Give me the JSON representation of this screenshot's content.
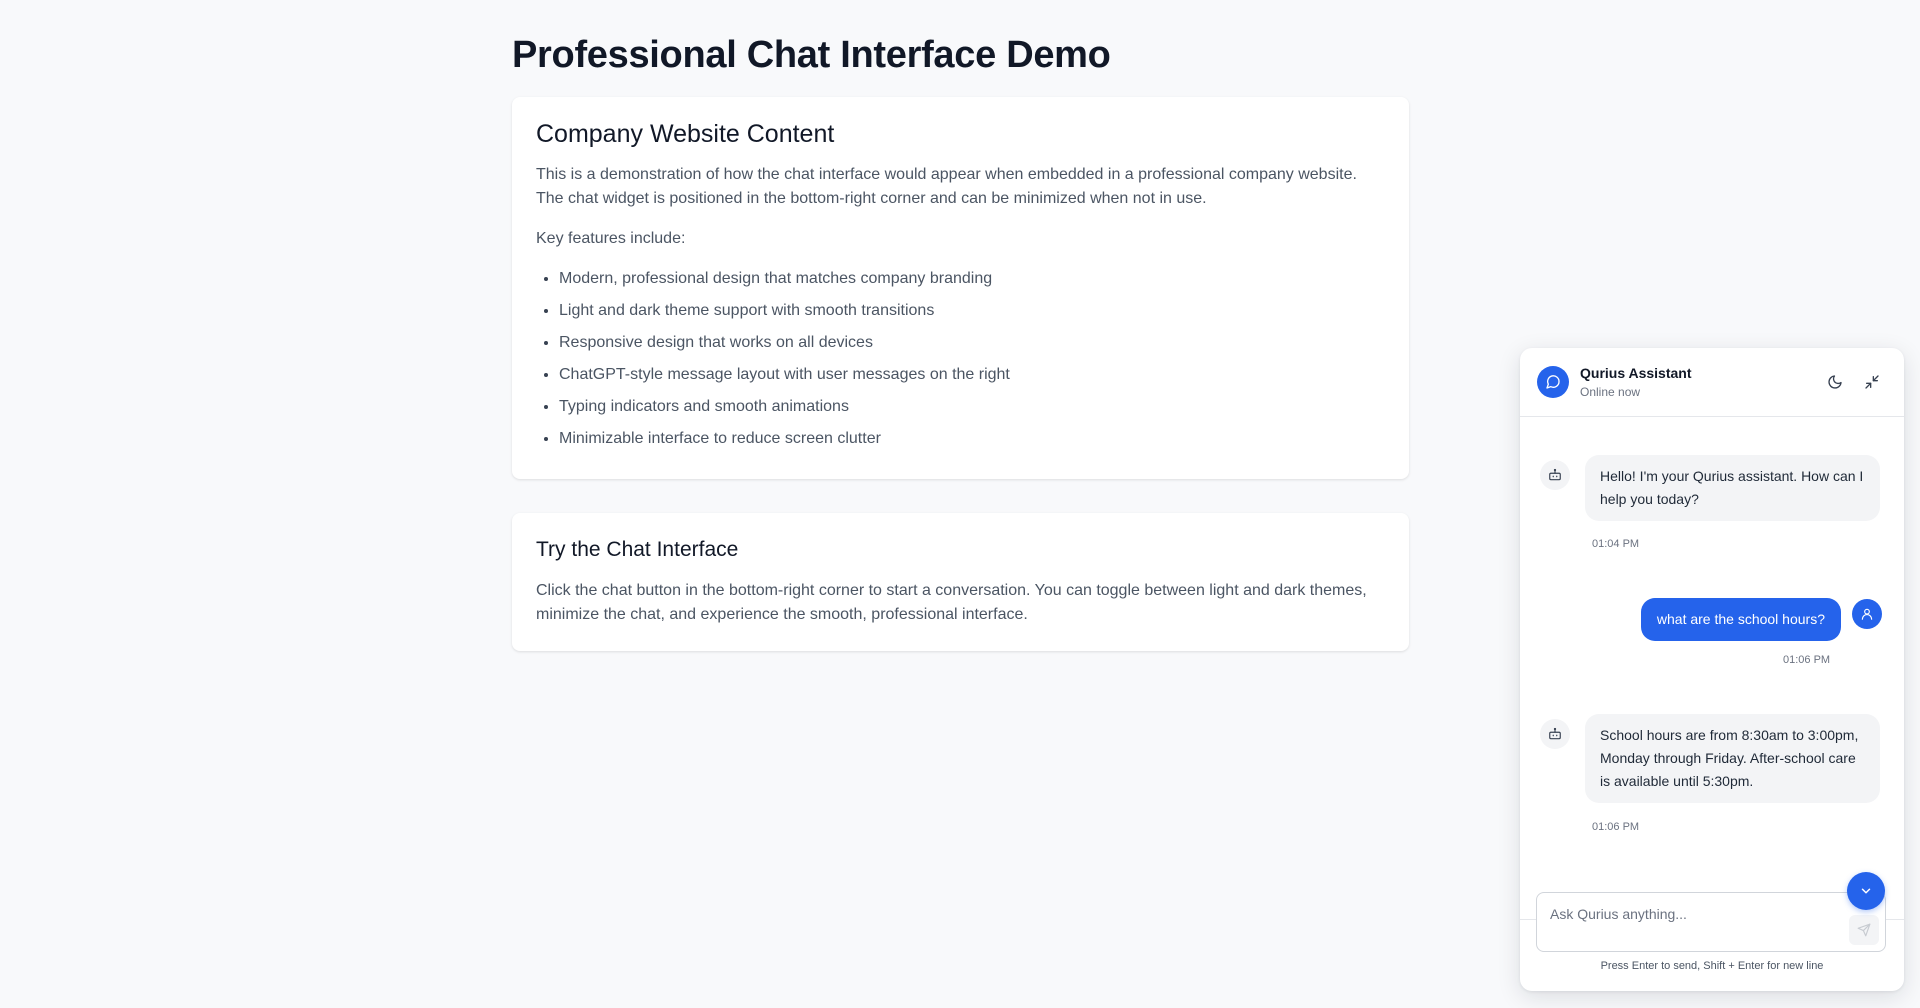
{
  "page": {
    "title": "Professional Chat Interface Demo"
  },
  "company_card": {
    "heading": "Company Website Content",
    "paragraph": "This is a demonstration of how the chat interface would appear when embedded in a professional company website. The chat widget is positioned in the bottom-right corner and can be minimized when not in use.",
    "features_intro": "Key features include:",
    "features": [
      "Modern, professional design that matches company branding",
      "Light and dark theme support with smooth transitions",
      "Responsive design that works on all devices",
      "ChatGPT-style message layout with user messages on the right",
      "Typing indicators and smooth animations",
      "Minimizable interface to reduce screen clutter"
    ]
  },
  "try_card": {
    "heading": "Try the Chat Interface",
    "paragraph": "Click the chat button in the bottom-right corner to start a conversation. You can toggle between light and dark themes, minimize the chat, and experience the smooth, professional interface."
  },
  "chat": {
    "name": "Qurius Assistant",
    "status": "Online now",
    "header_icons": {
      "avatar": "chat-bubble-icon",
      "theme": "moon-icon",
      "minimize": "minimize-arrows-icon"
    },
    "messages": [
      {
        "role": "bot",
        "text": "Hello! I'm your Qurius assistant. How can I help you today?",
        "time": "01:04 PM"
      },
      {
        "role": "user",
        "text": "what are the school hours?",
        "time": "01:06 PM"
      },
      {
        "role": "bot",
        "text": "School hours are from 8:30am to 3:00pm, Monday through Friday. After-school care is available until 5:30pm.",
        "time": "01:06 PM"
      }
    ],
    "input_placeholder": "Ask Qurius anything...",
    "hint": "Press Enter to send, Shift + Enter for new line"
  },
  "colors": {
    "accent": "#2563eb",
    "page_background": "#f8f9fb",
    "card_background": "#ffffff",
    "bot_bubble": "#f3f4f6",
    "text_primary": "#111827",
    "text_secondary": "#4b5563"
  }
}
